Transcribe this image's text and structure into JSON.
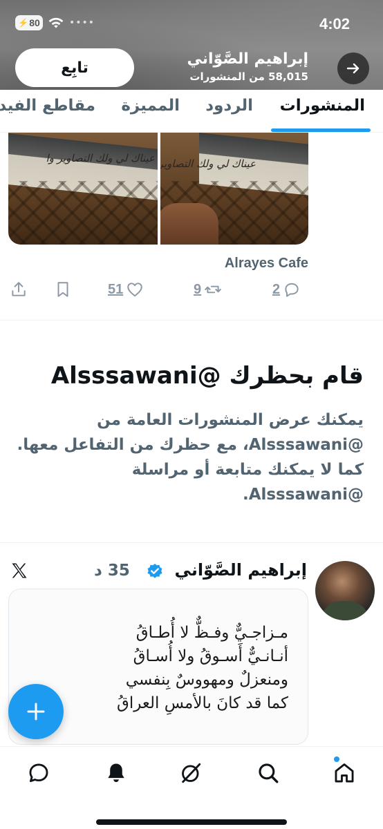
{
  "status_bar": {
    "time": "4:02",
    "battery": "80",
    "signal": "••••"
  },
  "header": {
    "follow_label": "تابِع",
    "profile_name": "إبراهيم الصَّوّاني",
    "posts_count": "58,015 من المنشورات"
  },
  "tabs": [
    {
      "label": "المنشورات",
      "active": true
    },
    {
      "label": "الردود",
      "active": false
    },
    {
      "label": "المميزة",
      "active": false
    },
    {
      "label": "مقاطع الفيديو",
      "active": false
    }
  ],
  "tweet1": {
    "image_left_sign_text": "عيناك لي ولك التصاوير وا",
    "image_right_sign_text": "عيناك لي ولك التصاوير وا",
    "location": "Alrayes Cafe",
    "replies": "2",
    "reposts": "9",
    "likes": "51"
  },
  "blocked": {
    "title": "قام بحظرك @Alsssawani",
    "body": "يمكنك عرض المنشورات العامة من @Alsssawani، مع حظرك من التفاعل معها. كما لا يمكنك متابعة أو مراسلة @Alsssawani."
  },
  "tweet2": {
    "author": "إبراهيم الصَّوّاني",
    "time": "35 د",
    "poem_lines": [
      "مـزاجـيٌّ وفـظٌّ لا أُطـاقُ",
      "أنـانـيٌّ أَسـوقُ ولا أُسـاقُ",
      "ومنعزلٌ ومهووسٌ بِنفسي",
      "كما قد كانَ بالأمسِ العراقُ"
    ]
  },
  "colors": {
    "accent": "#1d9bf0",
    "text_primary": "#0f1419",
    "text_secondary": "#536471"
  },
  "icons": {
    "header": [
      "arrow-right-icon",
      "wifi-icon"
    ],
    "actions": [
      "share-icon",
      "bookmark-icon",
      "heart-icon",
      "repost-icon",
      "reply-icon"
    ],
    "tweet2": [
      "verified-badge-icon",
      "x-logo-icon"
    ],
    "nav": [
      "chat-icon",
      "bell-icon",
      "grok-icon",
      "search-icon",
      "home-icon"
    ]
  }
}
